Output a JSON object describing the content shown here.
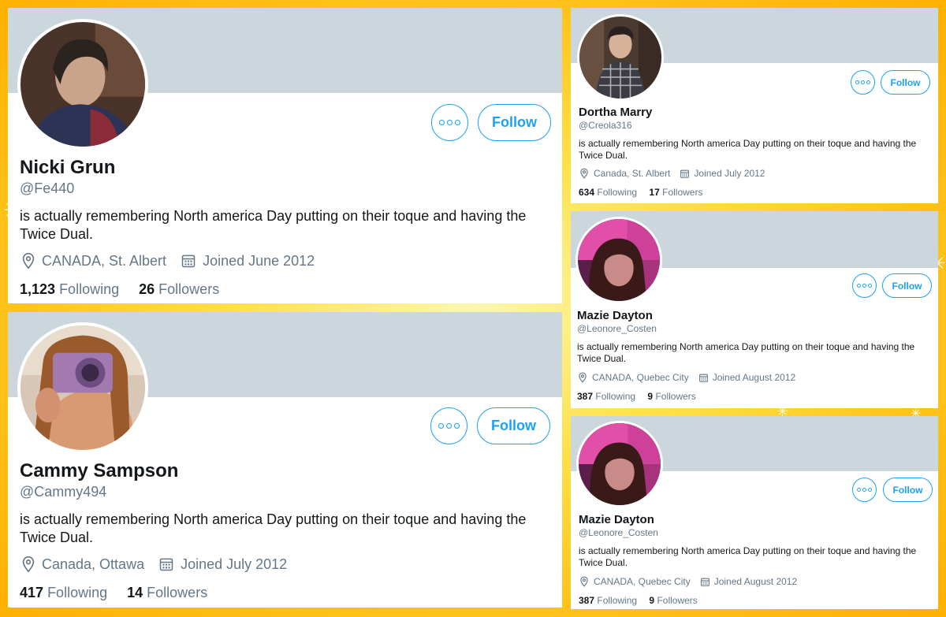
{
  "colors": {
    "accent": "#1da1f2",
    "banner": "#ccd6dd",
    "muted": "#657786",
    "text": "#14171a",
    "background": "#ffd21f"
  },
  "icons": {
    "more": "more-options-icon",
    "location": "location-pin-icon",
    "calendar": "calendar-icon"
  },
  "profiles": [
    {
      "name": "Nicki Grun",
      "handle": "@Fe440",
      "bio": "is actually remembering North america Day putting on their toque and having the Twice Dual.",
      "location": "CANADA, St. Albert",
      "joined": "Joined June 2012",
      "following_count": "1,123",
      "following_label": "Following",
      "followers_count": "26",
      "followers_label": "Followers",
      "follow_label": "Follow"
    },
    {
      "name": "Cammy Sampson",
      "handle": "@Cammy494",
      "bio": "is actually remembering North america Day putting on their toque and having the Twice Dual.",
      "location": "Canada, Ottawa",
      "joined": "Joined July 2012",
      "following_count": "417",
      "following_label": "Following",
      "followers_count": "14",
      "followers_label": "Followers",
      "follow_label": "Follow"
    },
    {
      "name": "Dortha Marry",
      "handle": "@Creola316",
      "bio": "is actually remembering North america Day putting on their toque and having the Twice Dual.",
      "location": "Canada, St. Albert",
      "joined": "Joined July 2012",
      "following_count": "634",
      "following_label": "Following",
      "followers_count": "17",
      "followers_label": "Followers",
      "follow_label": "Follow"
    },
    {
      "name": "Mazie Dayton",
      "handle": "@Leonore_Costen",
      "bio": "is actually remembering North america Day putting on their toque and having the Twice Dual.",
      "location": "CANADA, Quebec City",
      "joined": "Joined August 2012",
      "following_count": "387",
      "following_label": "Following",
      "followers_count": "9",
      "followers_label": "Followers",
      "follow_label": "Follow"
    },
    {
      "name": "Mazie Dayton",
      "handle": "@Leonore_Costen",
      "bio": "is actually remembering North america Day putting on their toque and having the Twice Dual.",
      "location": "CANADA, Quebec City",
      "joined": "Joined August 2012",
      "following_count": "387",
      "following_label": "Following",
      "followers_count": "9",
      "followers_label": "Followers",
      "follow_label": "Follow"
    }
  ]
}
